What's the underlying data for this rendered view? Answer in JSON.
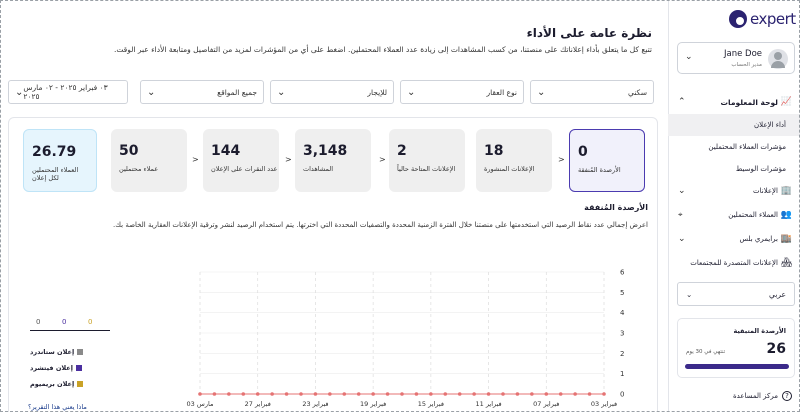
{
  "header": {
    "title": "نظرة عامة على الأداء",
    "description": "تتبع كل ما يتعلق بأداء إعلاناتك على منصتنا، من كسب المشاهدات إلى زيادة عدد العملاء المحتملين. اضغط على أي من المؤشرات لمزيد من التفاصيل ومتابعة الأداء عبر الوقت."
  },
  "filters": {
    "type": "سكني",
    "property_type": "نوع العقار",
    "purpose": "للإيجار",
    "location": "جميع المواقع",
    "date_range": "٠٣ فبراير ٢٠٢٥ - ٠٢ مارس ٢٠٢٥"
  },
  "stats": [
    {
      "value": "0",
      "label": "الأرصدة المُنفقة"
    },
    {
      "value": "18",
      "label": "الإعلانات المنشورة"
    },
    {
      "value": "2",
      "label": "الإعلانات المتاحة حالياً"
    },
    {
      "value": "3,148",
      "label": "المشاهدات"
    },
    {
      "value": "144",
      "label": "عدد النقرات على الإعلان"
    },
    {
      "value": "50",
      "label": "عملاء محتملين"
    },
    {
      "value": "26.79",
      "label": "العملاء المحتملين لكل إعلان"
    }
  ],
  "section": {
    "title": "الأرصدة المُنفقة",
    "description": "اعرض إجمالي عدد نقاط الرصيد التي استخدمتها على منصتنا خلال الفترة الزمنية المحددة والتصفيات المحددة التي اخترتها. يتم استخدام الرصيد لنشر وترقية الإعلانات العقارية الخاصة بك."
  },
  "legend": {
    "values": [
      "0",
      "0",
      "0"
    ],
    "items": [
      {
        "label": "إعلان ستاندرد",
        "color": "#8a8a8a"
      },
      {
        "label": "إعلان فيتشرد",
        "color": "#4b2fa0"
      },
      {
        "label": "إعلان بريميوم",
        "color": "#c9a227"
      }
    ]
  },
  "help_note": "ماذا يعني هذا التقرير؟",
  "chart_data": {
    "type": "line",
    "x": [
      "03 مارس",
      "27 فبراير",
      "23 فبراير",
      "19 فبراير",
      "15 فبراير",
      "11 فبراير",
      "07 فبراير",
      "03 فبراير"
    ],
    "y_ticks": [
      "0",
      "1",
      "2",
      "3",
      "4",
      "5",
      "6"
    ],
    "ylim": [
      0,
      6
    ],
    "points_per_day": 29,
    "series": [
      {
        "values": [
          0,
          0,
          0,
          0,
          0,
          0,
          0,
          0,
          0,
          0,
          0,
          0,
          0,
          0,
          0,
          0,
          0,
          0,
          0,
          0,
          0,
          0,
          0,
          0,
          0,
          0,
          0,
          0,
          0
        ],
        "color": "#e57373"
      }
    ],
    "grid": true
  },
  "sidebar": {
    "logo_text": "expert",
    "user": {
      "name": "Jane Doe",
      "role": "مدير الحساب"
    },
    "items": [
      {
        "label": "لوحة المعلومات",
        "kind": "head"
      },
      {
        "label": "أداء الإعلان",
        "kind": "sub"
      },
      {
        "label": "مؤشرات العملاء المحتملين",
        "kind": "sub"
      },
      {
        "label": "مؤشرات الوسيط",
        "kind": "sub"
      },
      {
        "label": "الإعلانات",
        "kind": "item"
      },
      {
        "label": "العملاء المحتملين",
        "kind": "item"
      },
      {
        "label": "برايمري بلس",
        "kind": "item"
      },
      {
        "label": "الإعلانات المتصدرة للمجتمعات",
        "kind": "item"
      }
    ],
    "language": "عربي",
    "balance": {
      "title": "الأرصدة المتبقية",
      "value": "26",
      "expiry": "تنتهي في 30 يوم"
    },
    "help_center": "مركز المساعدة"
  }
}
